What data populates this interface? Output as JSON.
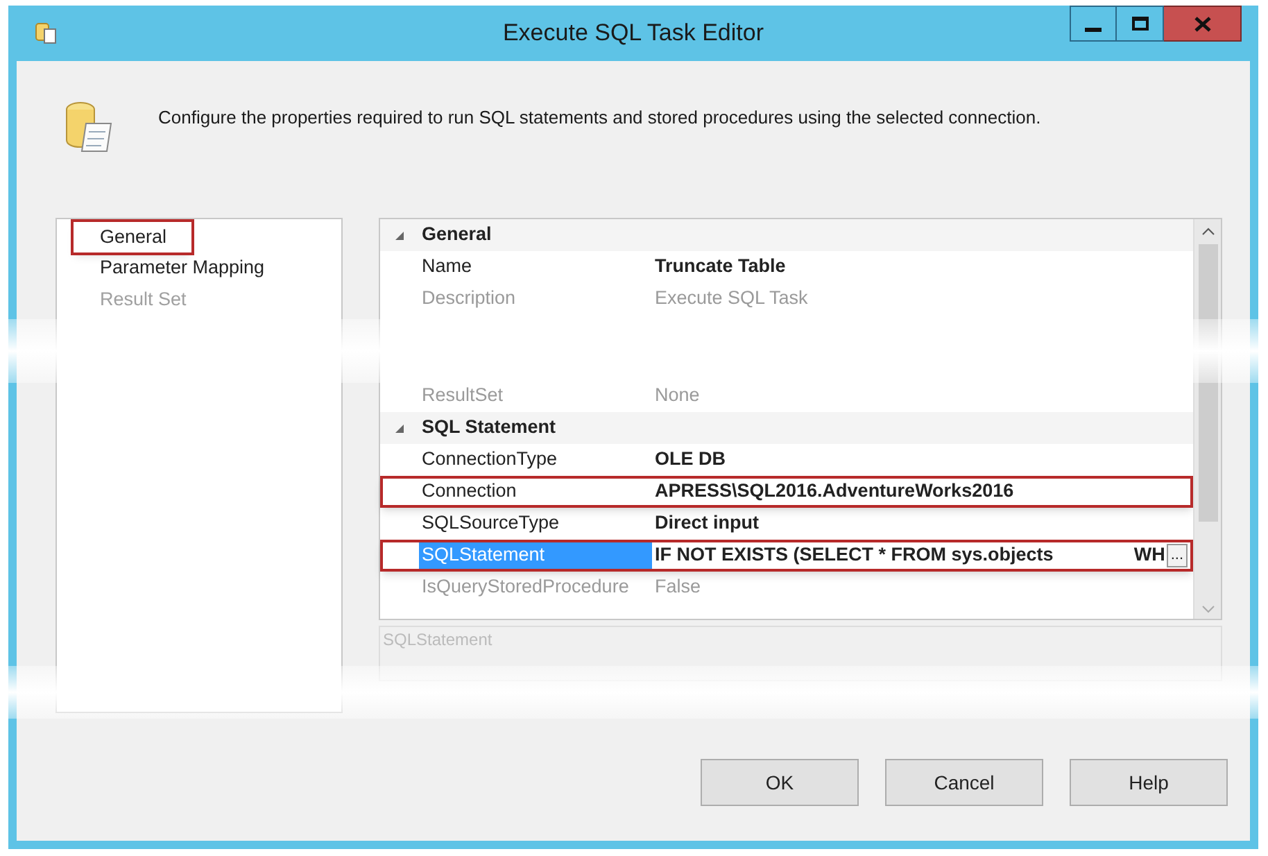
{
  "window": {
    "title": "Execute SQL Task Editor"
  },
  "description": "Configure the properties required to run SQL statements and stored procedures using the selected connection.",
  "pages": [
    {
      "label": "General",
      "highlighted": true,
      "disabled": false
    },
    {
      "label": "Parameter Mapping",
      "highlighted": false,
      "disabled": false
    },
    {
      "label": "Result Set",
      "highlighted": false,
      "disabled": true
    }
  ],
  "properties": [
    {
      "kind": "category",
      "label": "General",
      "expanded": true
    },
    {
      "kind": "property",
      "name": "Name",
      "value": "Truncate Table",
      "modified": true,
      "disabled": false,
      "selected": false,
      "highlighted": false
    },
    {
      "kind": "property",
      "name": "Description",
      "value": "Execute SQL Task",
      "modified": false,
      "disabled": true,
      "selected": false,
      "highlighted": false
    },
    {
      "kind": "property",
      "name": "ResultSet",
      "value": "None",
      "modified": false,
      "disabled": true,
      "selected": false,
      "highlighted": false
    },
    {
      "kind": "category",
      "label": "SQL Statement",
      "expanded": true
    },
    {
      "kind": "property",
      "name": "ConnectionType",
      "value": "OLE DB",
      "modified": true,
      "disabled": false,
      "selected": false,
      "highlighted": false
    },
    {
      "kind": "property",
      "name": "Connection",
      "value": "APRESS\\SQL2016.AdventureWorks2016",
      "modified": true,
      "disabled": false,
      "selected": false,
      "highlighted": true
    },
    {
      "kind": "property",
      "name": "SQLSourceType",
      "value": "Direct input",
      "modified": true,
      "disabled": false,
      "selected": false,
      "highlighted": false
    },
    {
      "kind": "property",
      "name": "SQLStatement",
      "value": "IF NOT EXISTS (SELECT * FROM sys.objects",
      "value_tail": "WH",
      "button": "...",
      "modified": true,
      "disabled": false,
      "selected": true,
      "highlighted": true
    },
    {
      "kind": "property",
      "name": "IsQueryStoredProcedure",
      "value": "False",
      "modified": false,
      "disabled": true,
      "selected": false,
      "highlighted": false
    }
  ],
  "help_title": "SQLStatement",
  "buttons": [
    "OK",
    "Cancel",
    "Help"
  ]
}
